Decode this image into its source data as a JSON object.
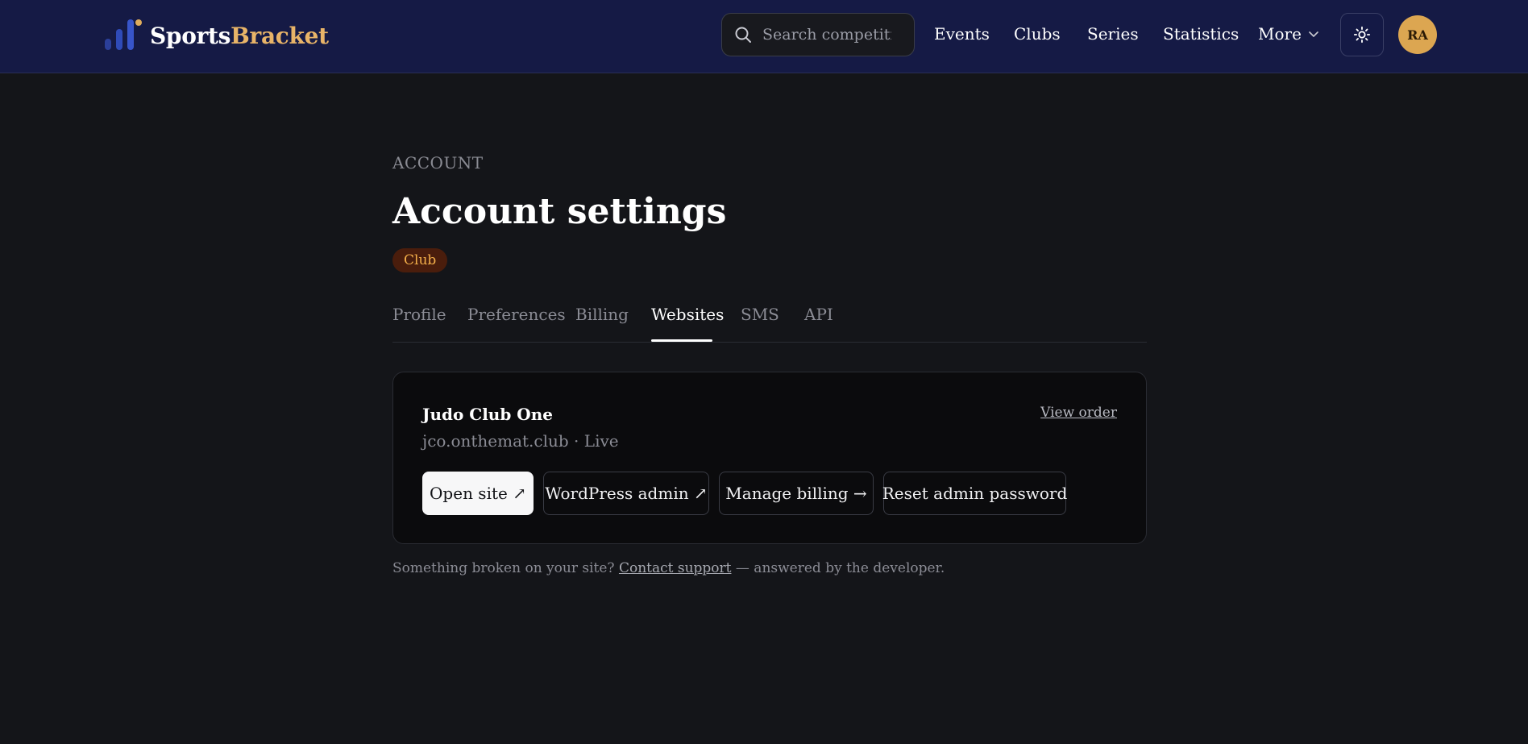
{
  "brand": {
    "part1": "Sports",
    "part2": "Bracket"
  },
  "search": {
    "placeholder": "Search competitions"
  },
  "nav": {
    "events": "Events",
    "clubs": "Clubs",
    "series": "Series",
    "statistics": "Statistics",
    "more": "More"
  },
  "user": {
    "initials": "RA"
  },
  "page": {
    "eyebrow": "ACCOUNT",
    "title": "Account settings",
    "badge": "Club"
  },
  "tabs": [
    {
      "label": "Profile"
    },
    {
      "label": "Preferences"
    },
    {
      "label": "Billing"
    },
    {
      "label": "Websites"
    },
    {
      "label": "SMS"
    },
    {
      "label": "API"
    }
  ],
  "site": {
    "name": "Judo Club One",
    "domain": "jco.onthemat.club",
    "separator": " · ",
    "status": "Live",
    "view_order": "View order",
    "buttons": {
      "open_site": "Open site ↗",
      "wp_admin": "WordPress admin ↗",
      "manage_billing": "Manage billing →",
      "reset_password": "Reset admin password"
    }
  },
  "footer": {
    "prefix": "Something broken on your site? ",
    "link": "Contact support",
    "suffix": " — answered by the developer."
  },
  "colors": {
    "topbar": "#151a45",
    "accent": "#e8b468",
    "badge_bg": "#4a1d0c",
    "badge_fg": "#f5b04a"
  }
}
